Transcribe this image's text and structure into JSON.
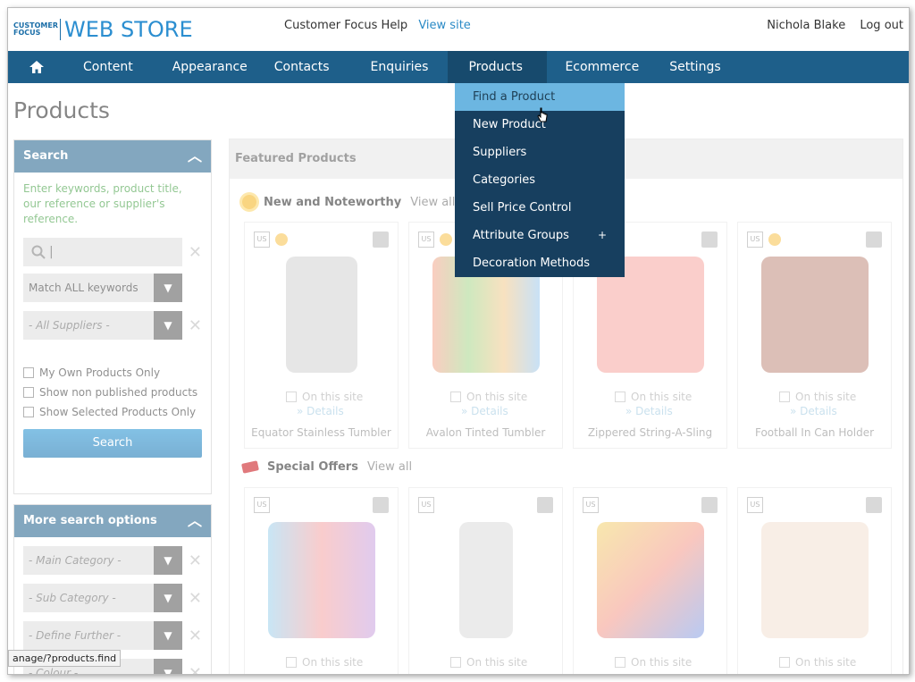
{
  "logo": {
    "small_top": "CUSTOMER",
    "small_bottom": "FOCUS",
    "big": "WEB STORE"
  },
  "toplinks": {
    "help": "Customer Focus Help",
    "view_site": "View site"
  },
  "user": {
    "name": "Nichola Blake",
    "logout": "Log out"
  },
  "nav": {
    "items": [
      "Content",
      "Appearance",
      "Contacts",
      "Enquiries",
      "Products",
      "Ecommerce",
      "Settings"
    ],
    "active": "Products"
  },
  "dropdown": [
    "Find a Product",
    "New Product",
    "Suppliers",
    "Categories",
    "Sell Price Control",
    "Attribute Groups",
    "Decoration Methods"
  ],
  "dropdown_plus": "+",
  "page_title": "Products",
  "search_panel": {
    "title": "Search",
    "hint": "Enter keywords, product title, our reference or supplier's reference.",
    "search_value": "|",
    "match_select": "Match ALL keywords",
    "supplier_select": "- All Suppliers -",
    "checks": [
      "My Own Products Only",
      "Show non published products",
      "Show Selected Products Only"
    ],
    "button": "Search"
  },
  "more_panel": {
    "title": "More search options",
    "selects": [
      "- Main Category -",
      "- Sub Category -",
      "- Define Further -",
      "- Colour -"
    ]
  },
  "featured": {
    "title": "Featured Products",
    "sections": [
      {
        "title": "New and Noteworthy",
        "view_all": "View all",
        "products": [
          {
            "name": "Equator Stainless Tumbler",
            "color": "#cfcfcf"
          },
          {
            "name": "Avalon Tinted Tumbler",
            "color": "#f0b38a"
          },
          {
            "name": "Zippered String-A-Sling",
            "color": "#f5a19a"
          },
          {
            "name": "Football In Can Holder",
            "color": "#b67a6a"
          }
        ]
      },
      {
        "title": "Special Offers",
        "view_all": "View all",
        "products": [
          {
            "name": "",
            "color": "#a9cfe4"
          },
          {
            "name": "",
            "color": "#d8d8d8"
          },
          {
            "name": "",
            "color": "#e9c46a"
          },
          {
            "name": "",
            "color": "#f1dccd"
          }
        ]
      }
    ],
    "on_site": "On this site",
    "details": "» Details",
    "us": "US"
  },
  "status_url": "anage/?products.find"
}
